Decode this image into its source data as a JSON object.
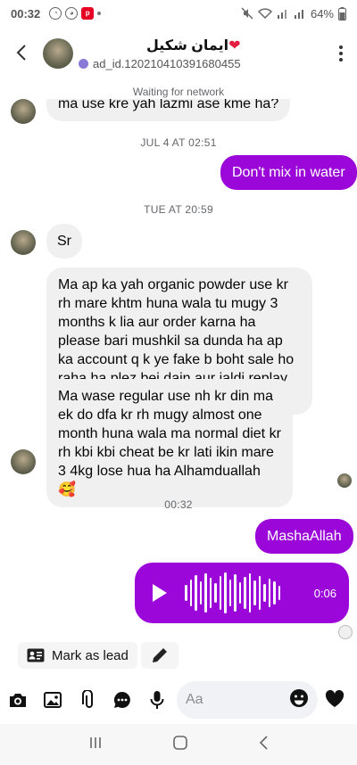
{
  "status_bar": {
    "time": "00:32",
    "battery": "64%"
  },
  "header": {
    "contact_name": "ایمان شکیل",
    "contact_heart": "❤",
    "ad_id": "ad_id.120210410391680455",
    "back_icon": "back-arrow-icon",
    "menu_icon": "kebab-menu-icon"
  },
  "network_status": "Waiting for network",
  "thread": {
    "partial_message": "ma use kre yah lazmi ase kme ha?",
    "date_1": "JUL 4 AT 02:51",
    "out_1": "Don't mix in water",
    "date_2": "TUE AT 20:59",
    "in_1": "Sr",
    "in_2": "Ma ap ka yah organic powder use kr rh mare khtm huna wala tu mugy 3 months k lia aur order karna ha please bari mushkil sa dunda ha ap ka account q k ye fake b boht sale ho raha ha plez bej dain aur jaldi replay kar dain?",
    "in_3": "Ma wase regular use nh kr din ma ek do dfa kr rh mugy almost one month huna wala ma normal diet kr rh kbi kbi cheat be kr lati ikin mare 3 4kg lose hua ha Alhamduallah 🥰",
    "date_3": "00:32",
    "out_2": "MashaAllah",
    "voice_duration": "0:06"
  },
  "actions": {
    "mark_as_lead": "Mark as lead"
  },
  "composer": {
    "placeholder": "Aa"
  },
  "colors": {
    "accent": "#9b07d8",
    "incoming_bubble": "#f0f0f0"
  }
}
